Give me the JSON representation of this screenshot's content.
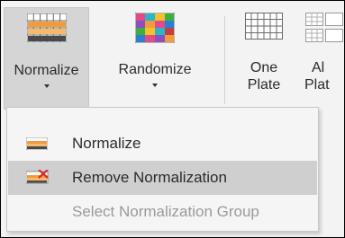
{
  "ribbon": {
    "normalize": {
      "label": "Normalize",
      "icon": "normalize-grid-icon"
    },
    "randomize": {
      "label": "Randomize",
      "icon": "randomize-grid-icon"
    },
    "one_plate": {
      "label_line1": "One",
      "label_line2": "Plate",
      "icon": "plate-grid-icon"
    },
    "all_plates": {
      "label_line1": "Al",
      "label_line2": "Plat",
      "icon": "multi-plate-grid-icon"
    }
  },
  "menu": {
    "items": [
      {
        "label": "Normalize",
        "icon": "normalize-icon",
        "state": "normal"
      },
      {
        "label": "Remove Normalization",
        "icon": "remove-normalization-icon",
        "state": "hover"
      },
      {
        "label": "Select Normalization Group",
        "icon": "",
        "state": "disabled"
      }
    ]
  },
  "colors": {
    "ribbon_bg": "#f3f3f3",
    "pressed_bg": "#d5d5d5",
    "menu_bg": "#f5f5f5",
    "hover_bg": "#cfcfcf",
    "text": "#2b2b2b",
    "disabled_text": "#9a9a9a"
  }
}
